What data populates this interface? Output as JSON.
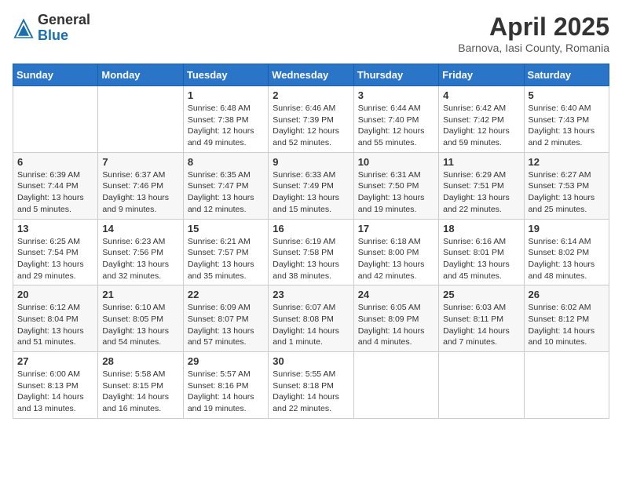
{
  "header": {
    "logo_general": "General",
    "logo_blue": "Blue",
    "month_year": "April 2025",
    "location": "Barnova, Iasi County, Romania"
  },
  "days_of_week": [
    "Sunday",
    "Monday",
    "Tuesday",
    "Wednesday",
    "Thursday",
    "Friday",
    "Saturday"
  ],
  "weeks": [
    [
      {
        "day": "",
        "info": ""
      },
      {
        "day": "",
        "info": ""
      },
      {
        "day": "1",
        "info": "Sunrise: 6:48 AM\nSunset: 7:38 PM\nDaylight: 12 hours and 49 minutes."
      },
      {
        "day": "2",
        "info": "Sunrise: 6:46 AM\nSunset: 7:39 PM\nDaylight: 12 hours and 52 minutes."
      },
      {
        "day": "3",
        "info": "Sunrise: 6:44 AM\nSunset: 7:40 PM\nDaylight: 12 hours and 55 minutes."
      },
      {
        "day": "4",
        "info": "Sunrise: 6:42 AM\nSunset: 7:42 PM\nDaylight: 12 hours and 59 minutes."
      },
      {
        "day": "5",
        "info": "Sunrise: 6:40 AM\nSunset: 7:43 PM\nDaylight: 13 hours and 2 minutes."
      }
    ],
    [
      {
        "day": "6",
        "info": "Sunrise: 6:39 AM\nSunset: 7:44 PM\nDaylight: 13 hours and 5 minutes."
      },
      {
        "day": "7",
        "info": "Sunrise: 6:37 AM\nSunset: 7:46 PM\nDaylight: 13 hours and 9 minutes."
      },
      {
        "day": "8",
        "info": "Sunrise: 6:35 AM\nSunset: 7:47 PM\nDaylight: 13 hours and 12 minutes."
      },
      {
        "day": "9",
        "info": "Sunrise: 6:33 AM\nSunset: 7:49 PM\nDaylight: 13 hours and 15 minutes."
      },
      {
        "day": "10",
        "info": "Sunrise: 6:31 AM\nSunset: 7:50 PM\nDaylight: 13 hours and 19 minutes."
      },
      {
        "day": "11",
        "info": "Sunrise: 6:29 AM\nSunset: 7:51 PM\nDaylight: 13 hours and 22 minutes."
      },
      {
        "day": "12",
        "info": "Sunrise: 6:27 AM\nSunset: 7:53 PM\nDaylight: 13 hours and 25 minutes."
      }
    ],
    [
      {
        "day": "13",
        "info": "Sunrise: 6:25 AM\nSunset: 7:54 PM\nDaylight: 13 hours and 29 minutes."
      },
      {
        "day": "14",
        "info": "Sunrise: 6:23 AM\nSunset: 7:56 PM\nDaylight: 13 hours and 32 minutes."
      },
      {
        "day": "15",
        "info": "Sunrise: 6:21 AM\nSunset: 7:57 PM\nDaylight: 13 hours and 35 minutes."
      },
      {
        "day": "16",
        "info": "Sunrise: 6:19 AM\nSunset: 7:58 PM\nDaylight: 13 hours and 38 minutes."
      },
      {
        "day": "17",
        "info": "Sunrise: 6:18 AM\nSunset: 8:00 PM\nDaylight: 13 hours and 42 minutes."
      },
      {
        "day": "18",
        "info": "Sunrise: 6:16 AM\nSunset: 8:01 PM\nDaylight: 13 hours and 45 minutes."
      },
      {
        "day": "19",
        "info": "Sunrise: 6:14 AM\nSunset: 8:02 PM\nDaylight: 13 hours and 48 minutes."
      }
    ],
    [
      {
        "day": "20",
        "info": "Sunrise: 6:12 AM\nSunset: 8:04 PM\nDaylight: 13 hours and 51 minutes."
      },
      {
        "day": "21",
        "info": "Sunrise: 6:10 AM\nSunset: 8:05 PM\nDaylight: 13 hours and 54 minutes."
      },
      {
        "day": "22",
        "info": "Sunrise: 6:09 AM\nSunset: 8:07 PM\nDaylight: 13 hours and 57 minutes."
      },
      {
        "day": "23",
        "info": "Sunrise: 6:07 AM\nSunset: 8:08 PM\nDaylight: 14 hours and 1 minute."
      },
      {
        "day": "24",
        "info": "Sunrise: 6:05 AM\nSunset: 8:09 PM\nDaylight: 14 hours and 4 minutes."
      },
      {
        "day": "25",
        "info": "Sunrise: 6:03 AM\nSunset: 8:11 PM\nDaylight: 14 hours and 7 minutes."
      },
      {
        "day": "26",
        "info": "Sunrise: 6:02 AM\nSunset: 8:12 PM\nDaylight: 14 hours and 10 minutes."
      }
    ],
    [
      {
        "day": "27",
        "info": "Sunrise: 6:00 AM\nSunset: 8:13 PM\nDaylight: 14 hours and 13 minutes."
      },
      {
        "day": "28",
        "info": "Sunrise: 5:58 AM\nSunset: 8:15 PM\nDaylight: 14 hours and 16 minutes."
      },
      {
        "day": "29",
        "info": "Sunrise: 5:57 AM\nSunset: 8:16 PM\nDaylight: 14 hours and 19 minutes."
      },
      {
        "day": "30",
        "info": "Sunrise: 5:55 AM\nSunset: 8:18 PM\nDaylight: 14 hours and 22 minutes."
      },
      {
        "day": "",
        "info": ""
      },
      {
        "day": "",
        "info": ""
      },
      {
        "day": "",
        "info": ""
      }
    ]
  ]
}
